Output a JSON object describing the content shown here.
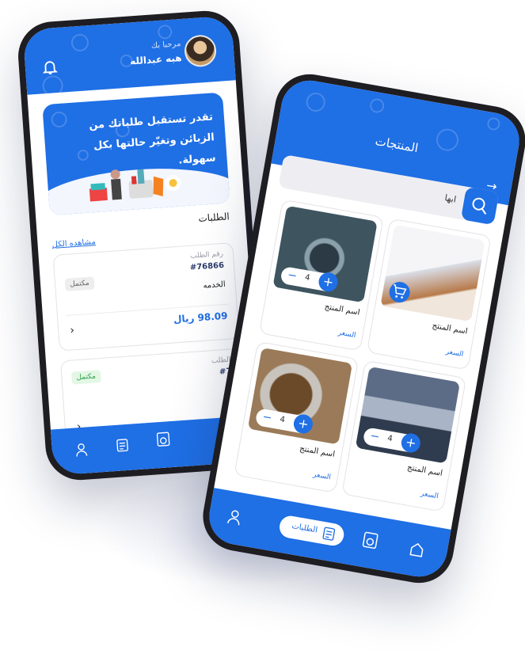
{
  "colors": {
    "primary": "#1f6fe5",
    "badge_grey": "#eeeeee",
    "badge_green": "#e3f7e5",
    "text": "#222222"
  },
  "phone_left": {
    "header": {
      "greeting": "مرحبا بك",
      "user_name": "هبه عبدالله",
      "bell_icon": "bell-icon",
      "avatar": "user-avatar"
    },
    "banner": {
      "text": "تقدر تستقبل طلباتك من الزبائن وتغيّر حالتها بكل سهولة."
    },
    "orders": {
      "section_title": "الطلبات",
      "view_all": "مشاهده الكل",
      "items": [
        {
          "label": "رقم الطلب",
          "number": "#76866",
          "service": "الخدمه",
          "status": "مكتمل",
          "price": "98.09 ريال"
        },
        {
          "label": "الطلب",
          "number": "#7",
          "status": "مكتمل"
        }
      ]
    },
    "nav": [
      "user-icon",
      "orders-icon",
      "washer-icon"
    ]
  },
  "phone_right": {
    "header": {
      "title": "المنتجات",
      "back_icon": "arrow-right-icon"
    },
    "search": {
      "value": "ابها",
      "icon": "search-icon"
    },
    "products": [
      {
        "name": "اسم المنتج",
        "price": "السعر",
        "quantity": "4"
      },
      {
        "name": "اسم المنتج",
        "price": "السعر"
      },
      {
        "name": "اسم المنتج",
        "price": "السعر",
        "quantity": "4"
      },
      {
        "name": "اسم المنتج",
        "price": "السعر",
        "quantity": "4"
      }
    ],
    "nav": {
      "active_label": "الطلبات",
      "icons": [
        "user-icon",
        "orders-icon",
        "washer-icon",
        "home-icon"
      ]
    }
  }
}
